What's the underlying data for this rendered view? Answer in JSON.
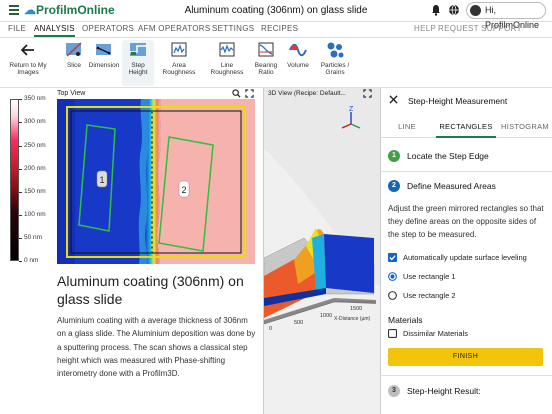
{
  "app": {
    "brand": "ProfilmOnline",
    "document_title": "Aluminum coating (306nm) on glass slide",
    "user_greeting": "Hi, ProfilmOnline"
  },
  "menu": {
    "items": [
      "FILE",
      "ANALYSIS",
      "OPERATORS",
      "AFM OPERATORS",
      "SETTINGS",
      "RECIPES"
    ],
    "active": "ANALYSIS",
    "right_items": [
      "HELP",
      "REQUEST SUPPORT"
    ]
  },
  "toolbar": {
    "back_label_1": "Return to My",
    "back_label_2": "Images",
    "tools": [
      {
        "icon": "slice-icon",
        "l1": "Slice",
        "l2": ""
      },
      {
        "icon": "dimension-icon",
        "l1": "Dimension",
        "l2": ""
      },
      {
        "icon": "step-height-icon",
        "l1": "Step",
        "l2": "Height"
      },
      {
        "icon": "area-roughness-icon",
        "l1": "Area",
        "l2": "Roughness"
      },
      {
        "icon": "line-roughness-icon",
        "l1": "Line",
        "l2": "Roughness"
      },
      {
        "icon": "bearing-ratio-icon",
        "l1": "Bearing",
        "l2": "Ratio"
      },
      {
        "icon": "volume-icon",
        "l1": "Volume",
        "l2": ""
      },
      {
        "icon": "particles-icon",
        "l1": "Particles /",
        "l2": "Grains"
      }
    ]
  },
  "colorbar": {
    "labels": [
      "350 nm",
      "300 nm",
      "250 nm",
      "200 nm",
      "150 nm",
      "100 nm",
      "50 nm",
      "0 nm"
    ]
  },
  "top_view": {
    "title": "Top View",
    "rect1_label": "1",
    "rect2_label": "2"
  },
  "description": {
    "title": "Aluminum coating (306nm) on glass slide",
    "text": "Aluminium coating with a average thickness of 306nm on a glass slide. The Aluminium deposition was done by a sputtering process. The scan shows a classical step height which was measured with Phase-shifting interometry done with a Profilm3D."
  },
  "view3d": {
    "title": "3D View (Recipe: Default...",
    "axis_z": "Z",
    "axis_x_label": "X-Distance (µm)",
    "x_ticks": [
      "0",
      "500",
      "1000",
      "1500"
    ]
  },
  "panel": {
    "title": "Step-Height Measurement",
    "tabs": [
      "LINE",
      "RECTANGLES",
      "HISTOGRAM"
    ],
    "active_tab": "RECTANGLES",
    "step1": {
      "num": "1",
      "label": "Locate the Step Edge"
    },
    "step2": {
      "num": "2",
      "label": "Define Measured Areas"
    },
    "instructions": "Adjust the green mirrored rectangles so that they define areas on the opposite sides of the step to be measured.",
    "auto_level_label": "Automatically update surface leveling",
    "use_rect1_label": "Use rectangle 1",
    "use_rect2_label": "Use rectangle 2",
    "materials_heading": "Materials",
    "dissimilar_label": "Dissimilar Materials",
    "finish_label": "FINISH",
    "step3": {
      "num": "3",
      "label": "Step-Height Result:"
    }
  },
  "colors": {
    "brand_green": "#1a7a4a",
    "step_active": "#1565c0",
    "step_done": "#43a047",
    "finish_button": "#f2c40c"
  }
}
